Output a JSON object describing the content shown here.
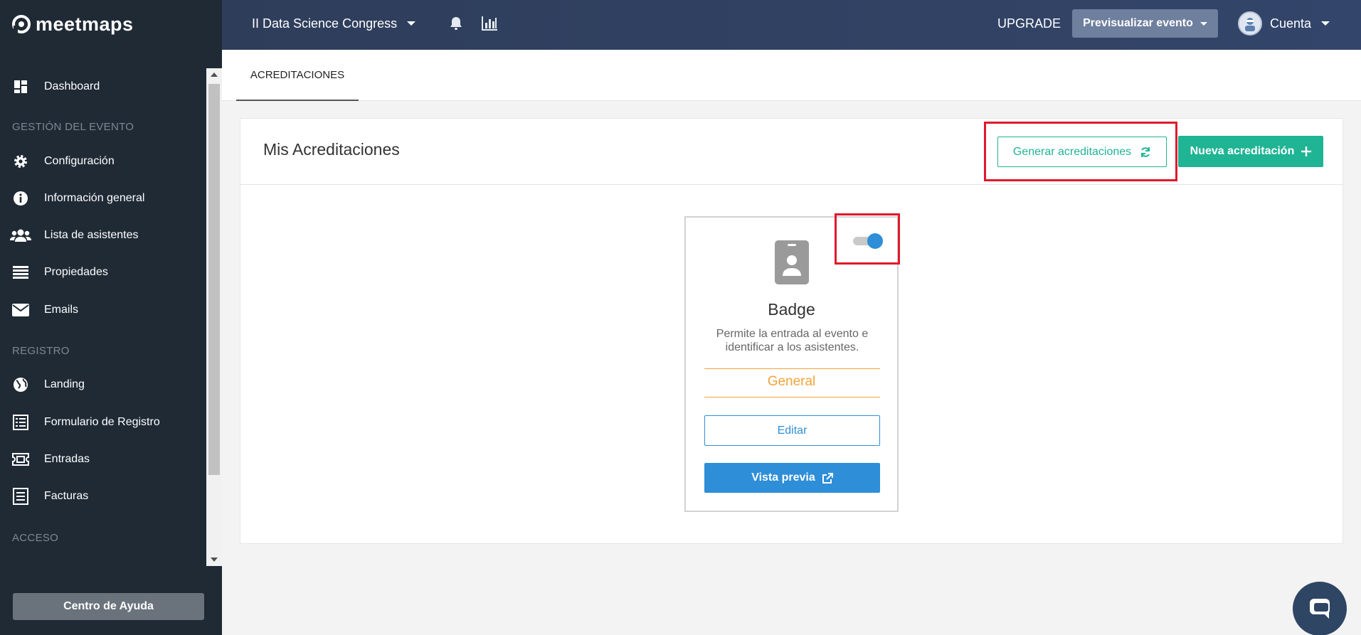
{
  "app": {
    "brand": "meetmaps",
    "brand_color": "#1f2a35",
    "accent": "#1fb494",
    "primary": "#2e8ed8"
  },
  "sidebar": {
    "items": [
      {
        "label": "Dashboard",
        "icon": "dashboard-icon"
      },
      {
        "label": "Configuración",
        "icon": "gear-icon"
      },
      {
        "label": "Información general",
        "icon": "info-icon"
      },
      {
        "label": "Lista de asistentes",
        "icon": "users-icon"
      },
      {
        "label": "Propiedades",
        "icon": "list-icon"
      },
      {
        "label": "Emails",
        "icon": "envelope-icon"
      },
      {
        "label": "Landing",
        "icon": "globe-icon"
      },
      {
        "label": "Formulario de Registro",
        "icon": "form-icon"
      },
      {
        "label": "Entradas",
        "icon": "ticket-icon"
      },
      {
        "label": "Facturas",
        "icon": "invoice-icon"
      }
    ],
    "sections": [
      "GESTIÓN DEL EVENTO",
      "REGISTRO",
      "ACCESO"
    ],
    "help_label": "Centro de Ayuda"
  },
  "header": {
    "event_name": "II Data Science Congress",
    "upgrade_label": "UPGRADE",
    "preview_label": "Previsualizar evento",
    "account_label": "Cuenta"
  },
  "tabs": [
    {
      "label": "ACREDITACIONES",
      "active": true
    }
  ],
  "main": {
    "title": "Mis Acreditaciones",
    "generate_label": "Generar acreditaciones",
    "new_label": "Nueva acreditación"
  },
  "badge": {
    "enabled": true,
    "title": "Badge",
    "description": "Permite la entrada al evento e identificar a los asistentes.",
    "category": "General",
    "edit_label": "Editar",
    "preview_label": "Vista previa"
  }
}
